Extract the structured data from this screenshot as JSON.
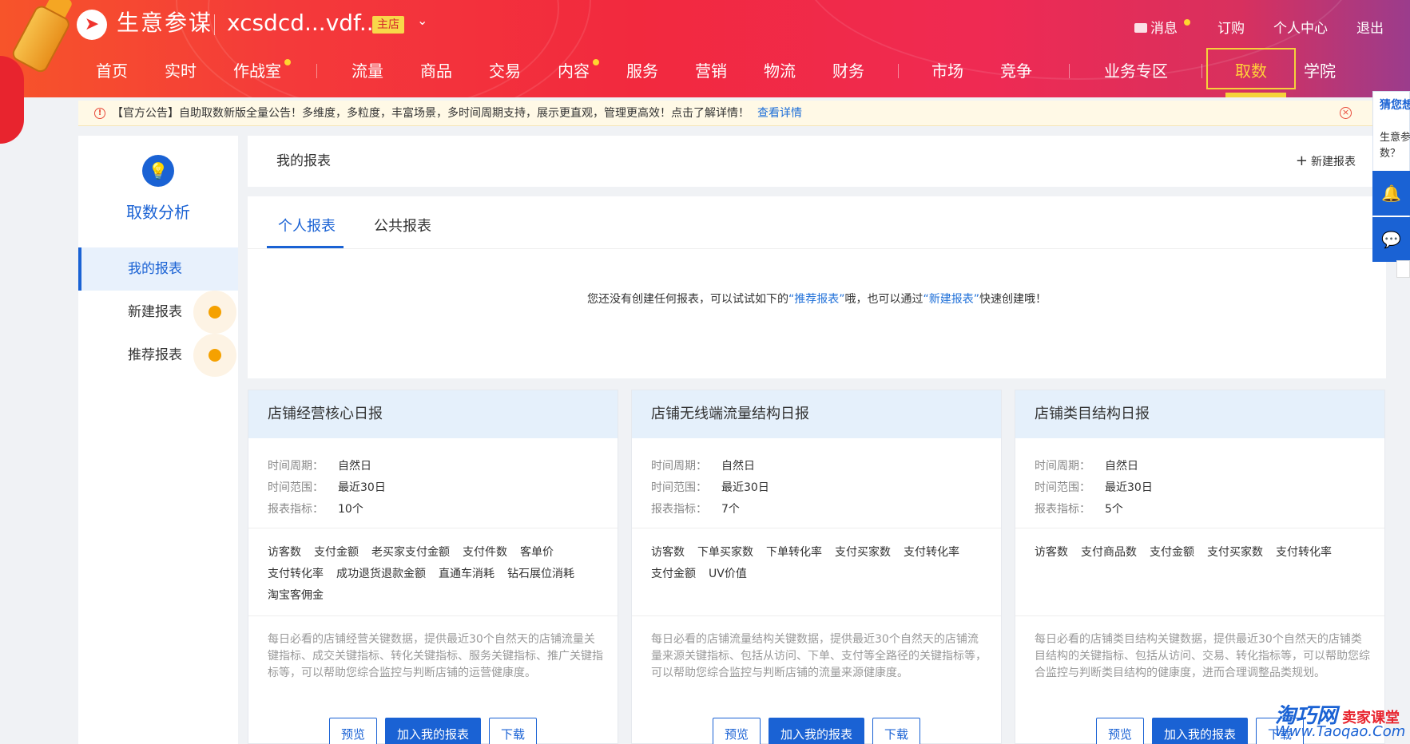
{
  "header": {
    "brand": "生意参谋",
    "shop_name": "xcsdcd...vdf...",
    "shop_badge": "主店",
    "top_links": {
      "messages": "消息",
      "subscribe": "订购",
      "personal": "个人中心",
      "logout": "退出"
    },
    "nav": [
      "首页",
      "实时",
      "作战室",
      "流量",
      "商品",
      "交易",
      "内容",
      "服务",
      "营销",
      "物流",
      "财务",
      "市场",
      "竞争",
      "业务专区",
      "取数",
      "学院"
    ],
    "active_nav": "取数"
  },
  "notice": {
    "text": "【官方公告】自助取数新版全量公告！多维度，多粒度，丰富场景，多时间周期支持，展示更直观，管理更高效！点击了解详情！",
    "link": "查看详情"
  },
  "sidebar": {
    "title": "取数分析",
    "items": [
      {
        "label": "我的报表",
        "active": true
      },
      {
        "label": "新建报表",
        "active": false
      },
      {
        "label": "推荐报表",
        "active": false
      }
    ]
  },
  "main": {
    "title": "我的报表",
    "new_report": "新建报表",
    "tabs": [
      "个人报表",
      "公共报表"
    ],
    "empty_prefix": "您还没有创建任何报表，可以试试如下的",
    "empty_link1": "“推荐报表”",
    "empty_mid": "哦，也可以通过",
    "empty_link2": "“新建报表”",
    "empty_suffix": "快速创建哦！"
  },
  "cards": [
    {
      "title": "店铺经营核心日报",
      "period_label": "时间周期：",
      "period": "自然日",
      "range_label": "时间范围：",
      "range": "最近30日",
      "metrics_label": "报表指标：",
      "metrics_count": "10个",
      "metrics": [
        "访客数",
        "支付金额",
        "老买家支付金额",
        "支付件数",
        "客单价",
        "支付转化率",
        "成功退货退款金额",
        "直通车消耗",
        "钻石展位消耗",
        "淘宝客佣金"
      ],
      "desc": "每日必看的店铺经营关键数据，提供最近30个自然天的店铺流量关键指标、成交关键指标、转化关键指标、服务关键指标、推广关键指标等，可以帮助您综合监控与判断店铺的运营健康度。",
      "btn_preview": "预览",
      "btn_add": "加入我的报表",
      "btn_download": "下载"
    },
    {
      "title": "店铺无线端流量结构日报",
      "period_label": "时间周期：",
      "period": "自然日",
      "range_label": "时间范围：",
      "range": "最近30日",
      "metrics_label": "报表指标：",
      "metrics_count": "7个",
      "metrics": [
        "访客数",
        "下单买家数",
        "下单转化率",
        "支付买家数",
        "支付转化率",
        "支付金额",
        "UV价值"
      ],
      "desc": "每日必看的店铺流量结构关键数据，提供最近30个自然天的店铺流量来源关键指标、包括从访问、下单、支付等全路径的关键指标等，可以帮助您综合监控与判断店铺的流量来源健康度。",
      "btn_preview": "预览",
      "btn_add": "加入我的报表",
      "btn_download": "下载"
    },
    {
      "title": "店铺类目结构日报",
      "period_label": "时间周期：",
      "period": "自然日",
      "range_label": "时间范围：",
      "range": "最近30日",
      "metrics_label": "报表指标：",
      "metrics_count": "5个",
      "metrics": [
        "访客数",
        "支付商品数",
        "支付金额",
        "支付买家数",
        "支付转化率"
      ],
      "desc": "每日必看的店铺类目结构关键数据，提供最近30个自然天的店铺类目结构的关键指标、包括从访问、交易、转化指标等，可以帮助您综合监控与判断类目结构的健康度，进而合理调整品类规划。",
      "btn_preview": "预览",
      "btn_add": "加入我的报表",
      "btn_download": "下载"
    }
  ],
  "float": {
    "head": "猜您想",
    "body": "生意参数？"
  },
  "watermark": {
    "site": "淘巧网",
    "tag": "卖家课堂",
    "url": "Www.Taoqao.Com"
  }
}
